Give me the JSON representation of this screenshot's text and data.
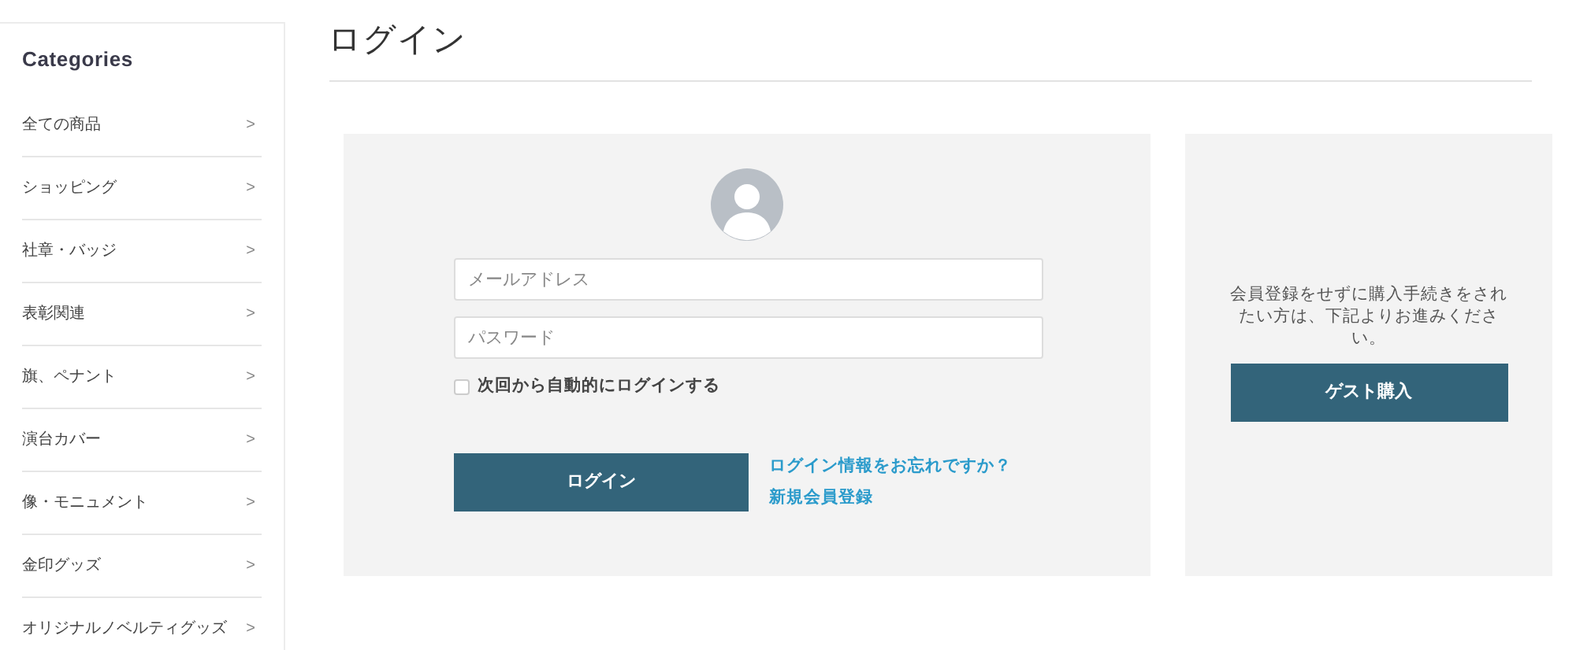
{
  "sidebar": {
    "title": "Categories",
    "items": [
      {
        "label": "全ての商品",
        "chevron": ">"
      },
      {
        "label": "ショッピング",
        "chevron": ">"
      },
      {
        "label": "社章・バッジ",
        "chevron": ">"
      },
      {
        "label": "表彰関連",
        "chevron": ">"
      },
      {
        "label": "旗、ペナント",
        "chevron": ">"
      },
      {
        "label": "演台カバー",
        "chevron": ">"
      },
      {
        "label": "像・モニュメント",
        "chevron": ">"
      },
      {
        "label": "金印グッズ",
        "chevron": ">"
      },
      {
        "label": "オリジナルノベルティグッズ",
        "chevron": ">"
      }
    ]
  },
  "page_title": "ログイン",
  "login": {
    "email": {
      "placeholder": "メールアドレス"
    },
    "password": {
      "placeholder": "パスワード"
    },
    "remember": {
      "label": "次回から自動的にログインする",
      "checked": false
    },
    "button": "ログイン",
    "links": [
      "ログイン情報をお忘れですか？",
      "新規会員登録"
    ]
  },
  "guest": {
    "message": "会員登録をせずに購入手続きをされたい方は、下記よりお進みください。",
    "button": "ゲスト購入"
  }
}
